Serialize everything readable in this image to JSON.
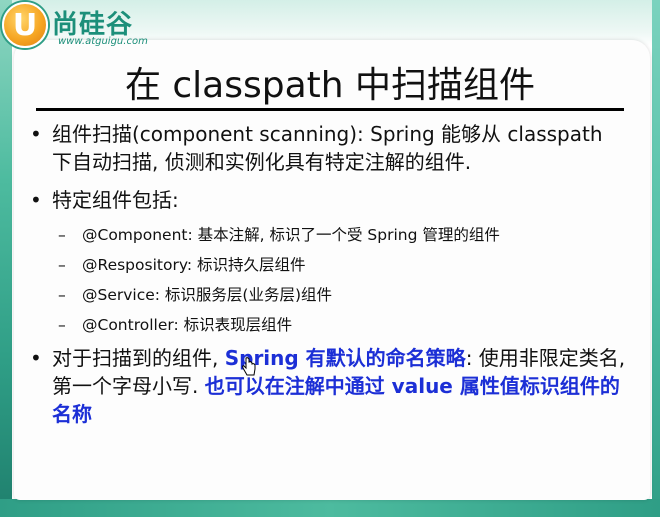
{
  "logo": {
    "mark_letter": "U",
    "name": "尚硅谷",
    "url": "www.atguigu.com"
  },
  "title": "在 classpath 中扫描组件",
  "bullets": [
    {
      "text": "组件扫描(component scanning): Spring 能够从 classpath 下自动扫描, 侦测和实例化具有特定注解的组件."
    },
    {
      "text": "特定组件包括:",
      "sub_items": [
        "@Component: 基本注解, 标识了一个受 Spring 管理的组件",
        "@Respository: 标识持久层组件",
        "@Service: 标识服务层(业务层)组件",
        "@Controller: 标识表现层组件"
      ]
    },
    {
      "text_plain_1": "对于扫描到的组件, ",
      "text_blue_1": "Spring 有默认的命名策略",
      "text_plain_2": ": 使用非限定类名, 第一个字母小写. ",
      "text_blue_2": "也可以在注解中通过 value 属性值标识组件的名称"
    }
  ],
  "colors": {
    "accent_teal": "#2f9e86",
    "emphasis_blue": "#1c2fd6",
    "logo_orange": "#f6a623"
  },
  "icons": {
    "bullet": "•",
    "dash": "–",
    "cursor": "hand-pointer-icon"
  }
}
